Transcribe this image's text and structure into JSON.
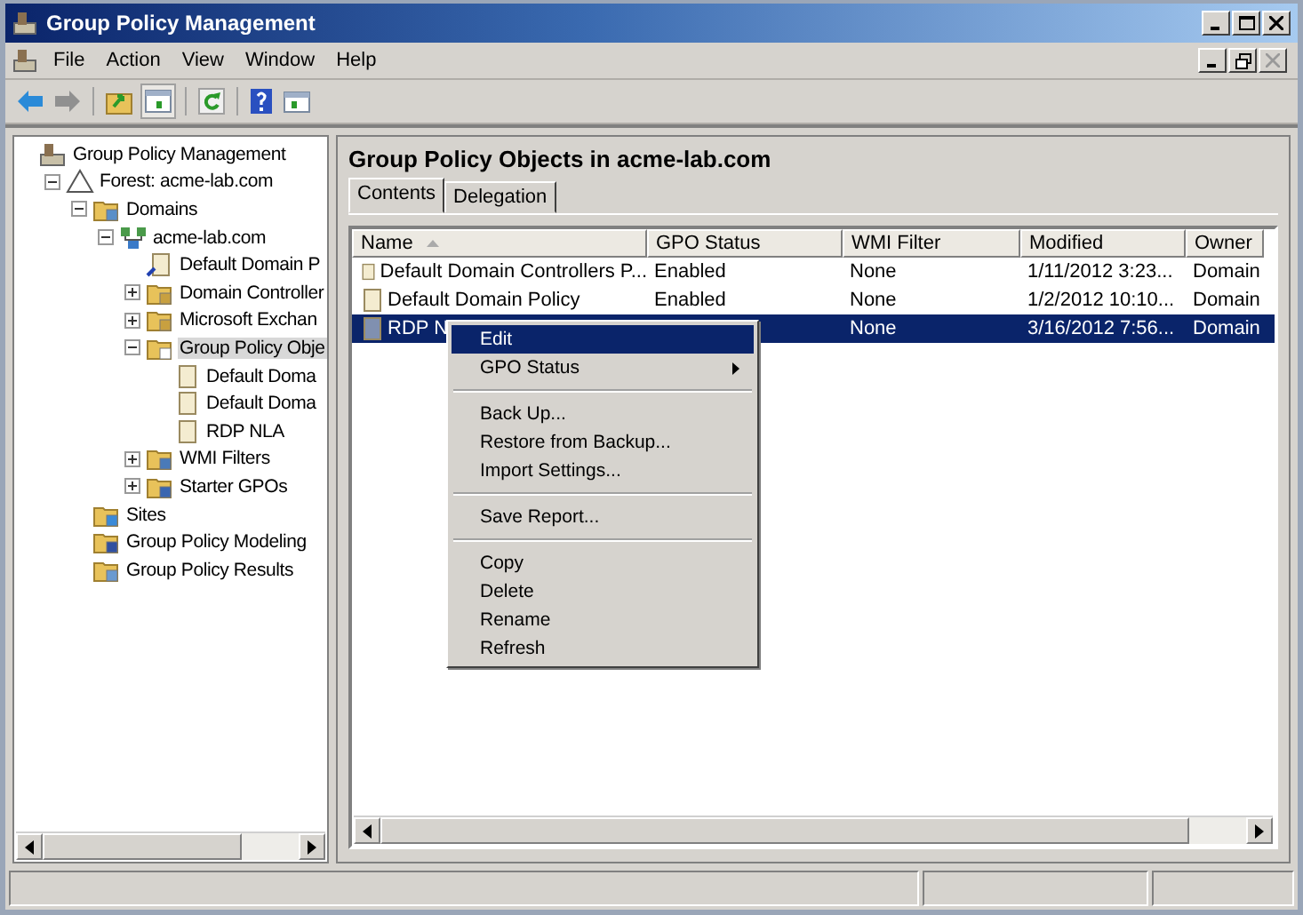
{
  "window": {
    "title": "Group Policy Management"
  },
  "menu_bar": [
    "File",
    "Action",
    "View",
    "Window",
    "Help"
  ],
  "tree": [
    {
      "label": "Group Policy Management",
      "kind": "console",
      "selected": false,
      "children": [
        {
          "label": "Forest: acme-lab.com",
          "kind": "forest",
          "expanded": true,
          "selected": false,
          "children": [
            {
              "label": "Domains",
              "kind": "folder",
              "expanded": true,
              "selected": false,
              "children": [
                {
                  "label": "acme-lab.com",
                  "kind": "domain",
                  "expanded": true,
                  "selected": false,
                  "children": [
                    {
                      "label": "Default Domain P",
                      "kind": "link",
                      "selected": false
                    },
                    {
                      "label": "Domain Controller",
                      "kind": "ou",
                      "expanded": false,
                      "selected": false
                    },
                    {
                      "label": "Microsoft Exchan",
                      "kind": "ou",
                      "expanded": false,
                      "selected": false
                    },
                    {
                      "label": "Group Policy Obje",
                      "kind": "gpofolder",
                      "expanded": true,
                      "selected": true,
                      "children": [
                        {
                          "label": "Default Doma",
                          "kind": "scroll",
                          "selected": false
                        },
                        {
                          "label": "Default Doma",
                          "kind": "scroll",
                          "selected": false
                        },
                        {
                          "label": "RDP NLA",
                          "kind": "scroll",
                          "selected": false
                        }
                      ]
                    },
                    {
                      "label": "WMI Filters",
                      "kind": "filter",
                      "expanded": false,
                      "selected": false
                    },
                    {
                      "label": "Starter GPOs",
                      "kind": "starter",
                      "expanded": false,
                      "selected": false
                    }
                  ]
                }
              ]
            },
            {
              "label": "Sites",
              "kind": "sites",
              "selected": false
            },
            {
              "label": "Group Policy Modeling",
              "kind": "modeling",
              "selected": false
            },
            {
              "label": "Group Policy Results",
              "kind": "results",
              "selected": false
            }
          ]
        }
      ]
    }
  ],
  "content": {
    "title": "Group Policy Objects in acme-lab.com",
    "tabs": [
      {
        "label": "Contents",
        "selected": true
      },
      {
        "label": "Delegation",
        "selected": false
      }
    ],
    "table": {
      "columns": [
        "Name",
        "GPO Status",
        "WMI Filter",
        "Modified",
        "Owner"
      ],
      "rows": [
        {
          "cells": [
            "Default Domain Controllers P...",
            "Enabled",
            "None",
            "1/11/2012 3:23...",
            "Domain"
          ],
          "selected": false
        },
        {
          "cells": [
            "Default Domain Policy",
            "Enabled",
            "None",
            "1/2/2012 10:10...",
            "Domain"
          ],
          "selected": false
        },
        {
          "cells": [
            "RDP N",
            "",
            "None",
            "3/16/2012 7:56...",
            "Domain"
          ],
          "selected": true
        }
      ]
    }
  },
  "context_menu": [
    {
      "kind": "item",
      "label": "Edit",
      "selected": true,
      "submenu": false
    },
    {
      "kind": "item",
      "label": "GPO Status",
      "selected": false,
      "submenu": true
    },
    {
      "kind": "separator"
    },
    {
      "kind": "item",
      "label": "Back Up...",
      "selected": false,
      "submenu": false
    },
    {
      "kind": "item",
      "label": "Restore from Backup...",
      "selected": false,
      "submenu": false
    },
    {
      "kind": "item",
      "label": "Import Settings...",
      "selected": false,
      "submenu": false
    },
    {
      "kind": "separator"
    },
    {
      "kind": "item",
      "label": "Save Report...",
      "selected": false,
      "submenu": false
    },
    {
      "kind": "separator"
    },
    {
      "kind": "item",
      "label": "Copy",
      "selected": false,
      "submenu": false
    },
    {
      "kind": "item",
      "label": "Delete",
      "selected": false,
      "submenu": false
    },
    {
      "kind": "item",
      "label": "Rename",
      "selected": false,
      "submenu": false
    },
    {
      "kind": "item",
      "label": "Refresh",
      "selected": false,
      "submenu": false
    }
  ]
}
